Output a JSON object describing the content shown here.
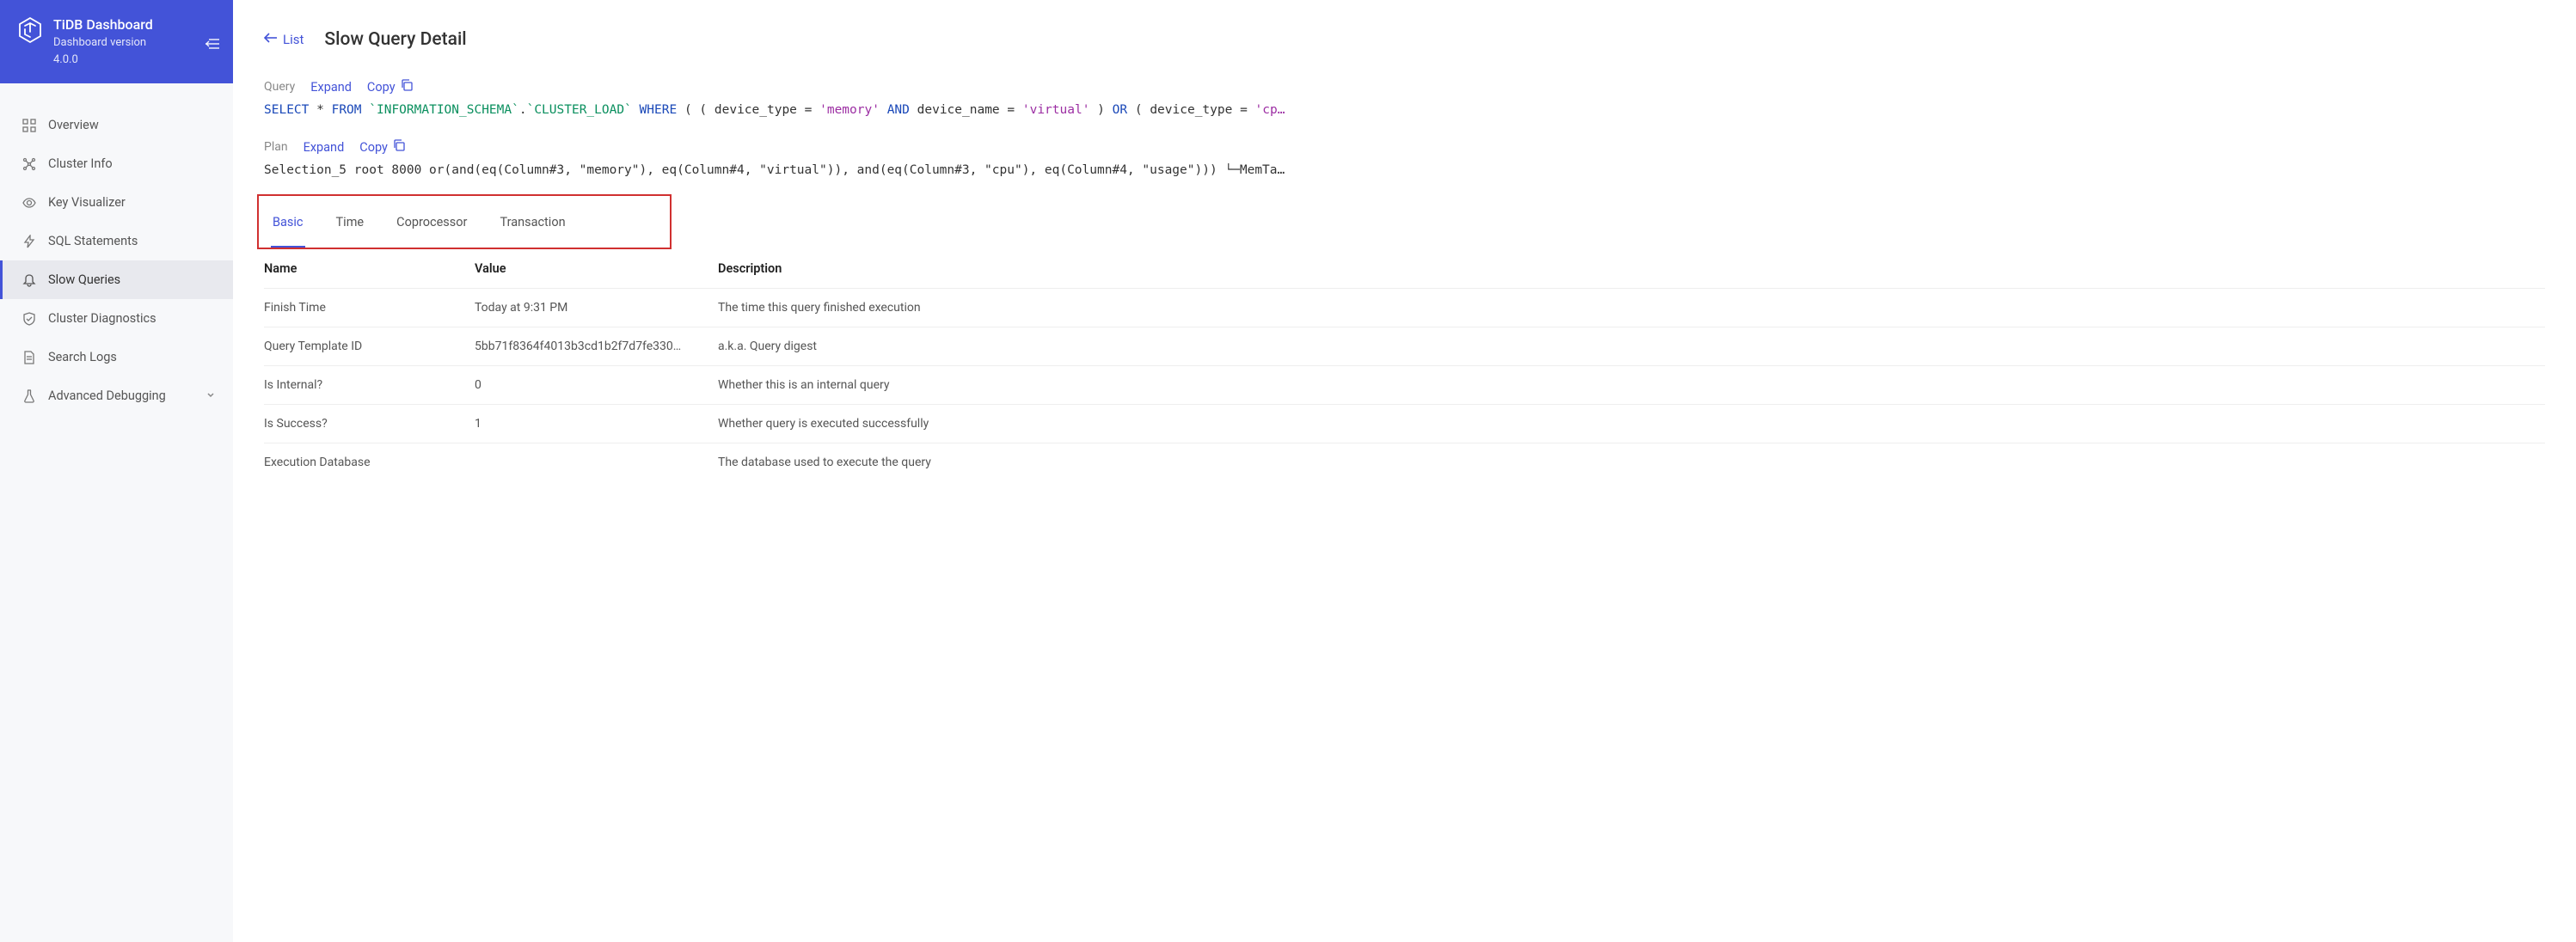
{
  "sidebar": {
    "header": {
      "title": "TiDB Dashboard",
      "subtitle": "Dashboard version",
      "version": "4.0.0"
    },
    "items": [
      {
        "icon": "overview",
        "label": "Overview"
      },
      {
        "icon": "cluster",
        "label": "Cluster Info"
      },
      {
        "icon": "keyviz",
        "label": "Key Visualizer"
      },
      {
        "icon": "sql",
        "label": "SQL Statements"
      },
      {
        "icon": "slow",
        "label": "Slow Queries"
      },
      {
        "icon": "diag",
        "label": "Cluster Diagnostics"
      },
      {
        "icon": "logs",
        "label": "Search Logs"
      },
      {
        "icon": "debug",
        "label": "Advanced Debugging"
      }
    ],
    "active_index": 4
  },
  "header": {
    "back_label": "List",
    "title": "Slow Query Detail"
  },
  "query_section": {
    "label": "Query",
    "expand_label": "Expand",
    "copy_label": "Copy",
    "sql": {
      "kw_select": "SELECT",
      "star": "*",
      "kw_from": "FROM",
      "tbl_schema": "`INFORMATION_SCHEMA`",
      "dot": ".",
      "tbl_name": "`CLUSTER_LOAD`",
      "kw_where": "WHERE",
      "paren_open1": "( (",
      "col1": "device_type",
      "eq": "=",
      "val1": "'memory'",
      "kw_and": "AND",
      "col2": "device_name",
      "val2": "'virtual'",
      "paren_close1": ")",
      "kw_or": "OR",
      "paren_open2": "(",
      "col3": "device_type",
      "val3": "'cp…"
    }
  },
  "plan_section": {
    "label": "Plan",
    "expand_label": "Expand",
    "copy_label": "Copy",
    "text": "Selection_5 root 8000 or(and(eq(Column#3, \"memory\"), eq(Column#4, \"virtual\")), and(eq(Column#3, \"cpu\"), eq(Column#4, \"usage\")))  └─MemTa…"
  },
  "tabs": {
    "items": [
      "Basic",
      "Time",
      "Coprocessor",
      "Transaction"
    ],
    "active_index": 0
  },
  "table": {
    "headers": {
      "name": "Name",
      "value": "Value",
      "description": "Description"
    },
    "rows": [
      {
        "name": "Finish Time",
        "value": "Today at 9:31 PM",
        "description": "The time this query finished execution"
      },
      {
        "name": "Query Template ID",
        "value": "5bb71f8364f4013b3cd1b2f7d7fe330…",
        "description": "a.k.a. Query digest"
      },
      {
        "name": "Is Internal?",
        "value": "0",
        "description": "Whether this is an internal query"
      },
      {
        "name": "Is Success?",
        "value": "1",
        "description": "Whether query is executed successfully"
      },
      {
        "name": "Execution Database",
        "value": "",
        "description": "The database used to execute the query"
      }
    ]
  }
}
